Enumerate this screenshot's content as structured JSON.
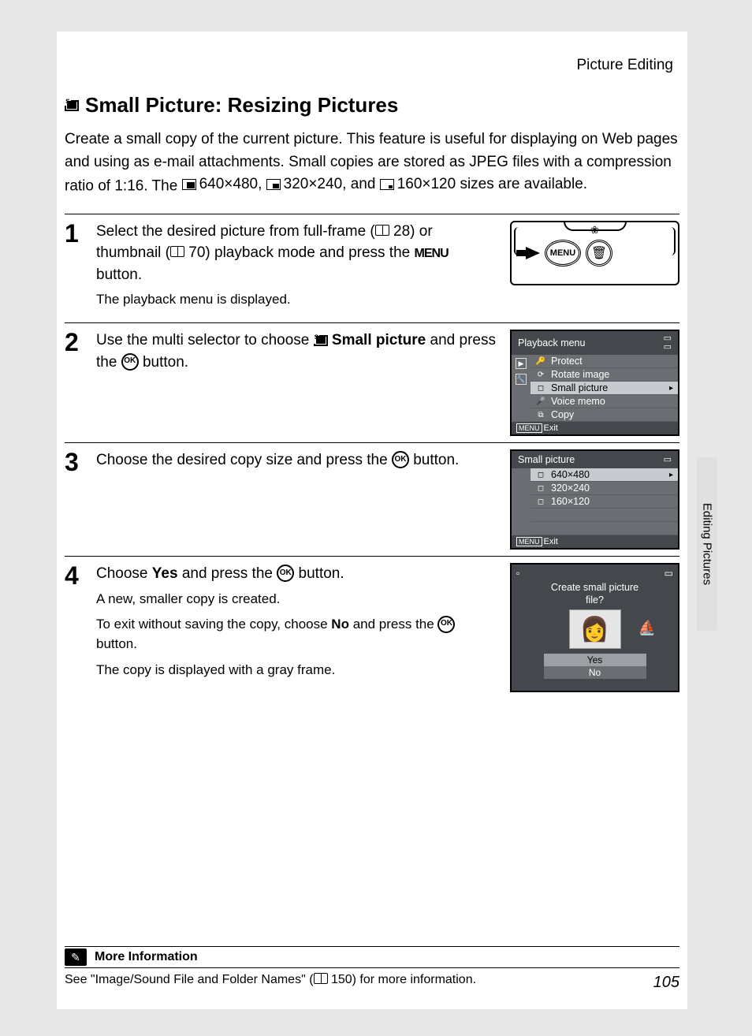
{
  "header": {
    "section": "Picture Editing"
  },
  "title": "Small Picture: Resizing Pictures",
  "intro": {
    "p1a": "Create a small copy of the current picture. This feature is useful for displaying on Web pages and using as e-mail attachments. Small copies are stored as JPEG files with a compression ratio of 1:16. The ",
    "s1": "640×480, ",
    "s2": "320×240, and ",
    "s3": "160×120 sizes are available."
  },
  "steps": [
    {
      "num": "1",
      "main_a": "Select the desired picture from full-frame (",
      "ref1": " 28) or thumbnail (",
      "ref2": " 70) playback mode and press the ",
      "menu": "MENU",
      "main_b": " button.",
      "sub": "The playback menu is displayed.",
      "cam": {
        "menu_label": "MENU",
        "trash": "🗑"
      }
    },
    {
      "num": "2",
      "main_a": "Use the multi selector to choose ",
      "bold": "Small picture",
      "main_b": " and press the ",
      "main_c": " button.",
      "lcd": {
        "title": "Playback menu",
        "items": [
          {
            "icon": "🔑",
            "label": "Protect"
          },
          {
            "icon": "⟳",
            "label": "Rotate image"
          },
          {
            "icon": "◻",
            "label": "Small picture",
            "sel": true
          },
          {
            "icon": "🎤",
            "label": "Voice memo"
          },
          {
            "icon": "⧉",
            "label": "Copy"
          }
        ],
        "foot": "Exit"
      }
    },
    {
      "num": "3",
      "main_a": "Choose the desired copy size and press the ",
      "main_b": " button.",
      "lcd": {
        "title": "Small picture",
        "items": [
          {
            "icon": "◻",
            "label": "640×480",
            "sel": true
          },
          {
            "icon": "◻",
            "label": "320×240"
          },
          {
            "icon": "◻",
            "label": "160×120"
          }
        ],
        "foot": "Exit"
      }
    },
    {
      "num": "4",
      "main_a": "Choose ",
      "bold": "Yes",
      "main_b": " and press the ",
      "main_c": " button.",
      "subs": [
        "A new, smaller copy is created.",
        "To exit without saving the copy, choose ",
        " and press the ",
        " button.",
        "The copy is displayed with a gray frame."
      ],
      "no": "No",
      "confirm": {
        "q1": "Create small picture",
        "q2": "file?",
        "yes": "Yes",
        "no": "No"
      }
    }
  ],
  "sidetab": "Editing Pictures",
  "more": {
    "heading": "More Information",
    "text_a": "See \"Image/Sound File and Folder Names\" (",
    "text_b": " 150) for more information."
  },
  "pagenum": "105",
  "ok_label": "OK"
}
